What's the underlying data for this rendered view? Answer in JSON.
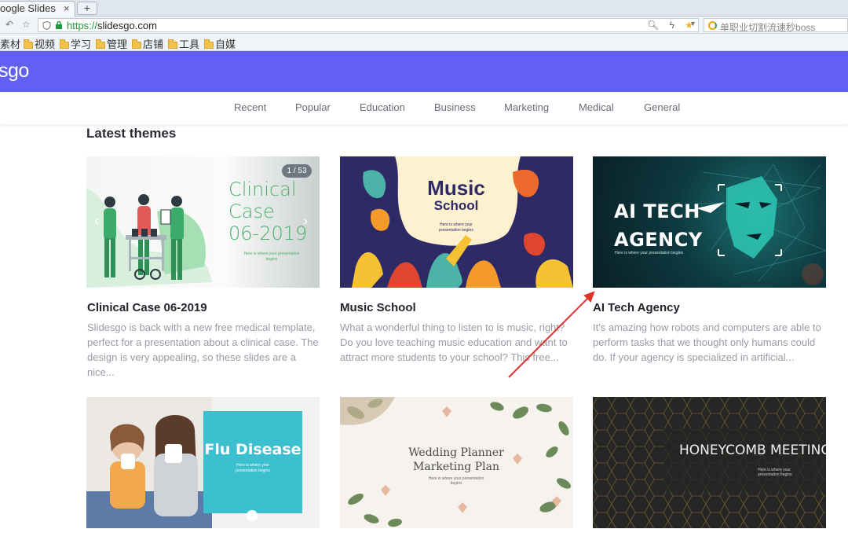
{
  "browser": {
    "tab_title": "oogle Slides",
    "tab_close": "×",
    "new_tab": "+",
    "url_protocol": "https://",
    "url_host": "slidesgo.com",
    "search_placeholder": "单职业切割流速秒boss"
  },
  "bookmarks": [
    {
      "label": "素材",
      "folder": false
    },
    {
      "label": "视频",
      "folder": true
    },
    {
      "label": "学习",
      "folder": true
    },
    {
      "label": "管理",
      "folder": true
    },
    {
      "label": "店铺",
      "folder": true
    },
    {
      "label": "工具",
      "folder": true
    },
    {
      "label": "自媒",
      "folder": true
    }
  ],
  "site": {
    "logo": "sgo",
    "brand_color": "#6160f2",
    "categories": [
      "Recent",
      "Popular",
      "Education",
      "Business",
      "Marketing",
      "Medical",
      "General"
    ],
    "section_title": "Latest themes"
  },
  "cards": [
    {
      "title": "Clinical Case 06-2019",
      "description": "Slidesgo is back with a new free medical template, perfect for a presentation about a clinical case. The design is very appealing, so these slides are a nice...",
      "thumb_title": "Clinical Case 06-2019",
      "thumb_title_lines": [
        "Clinical",
        "Case",
        "06-2019"
      ],
      "thumb_subtitle": "Here is where your presentation begins",
      "slide_counter": "1 / 53"
    },
    {
      "title": "Music School",
      "description": "What a wonderful thing to listen to is music, right? Do you love teaching music education and want to attract more students to your school? This free...",
      "thumb_title_lines": [
        "Music",
        "School"
      ],
      "thumb_subtitle": "Here is where your presentation begins"
    },
    {
      "title": "AI Tech Agency",
      "description": "It's amazing how robots and computers are able to perform tasks that we thought only humans could do. If your agency is specialized in artificial...",
      "thumb_title_lines": [
        "AI TECH",
        "AGENCY"
      ],
      "thumb_subtitle": "Here is where your presentation begins"
    },
    {
      "thumb_title": "Flu Disease",
      "thumb_subtitle": "Here is where your presentation begins"
    },
    {
      "thumb_title_lines": [
        "Wedding Planner",
        "Marketing Plan"
      ],
      "thumb_subtitle": "Here is where your presentation begins"
    },
    {
      "thumb_title": "HONEYCOMB MEETING",
      "thumb_subtitle": "Here is where your presentation begins"
    }
  ],
  "annotation": {
    "color": "#e0332b"
  }
}
